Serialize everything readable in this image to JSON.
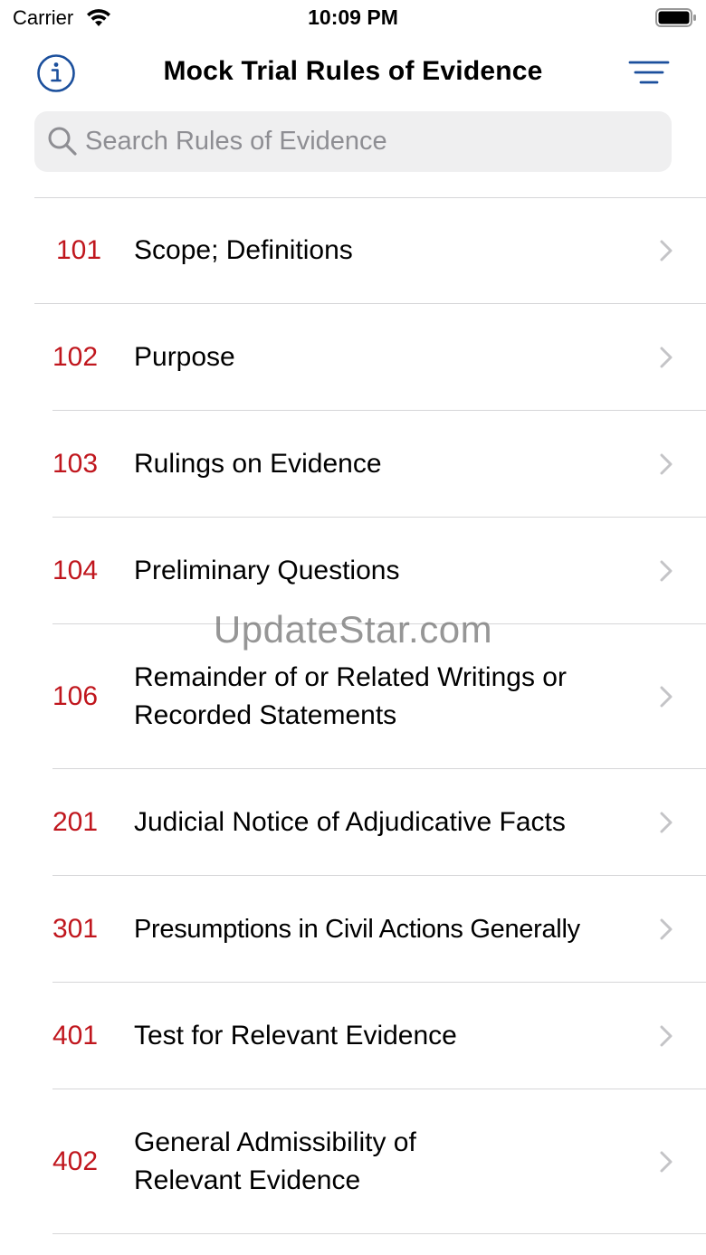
{
  "status_bar": {
    "carrier": "Carrier",
    "time": "10:09 PM"
  },
  "nav": {
    "title": "Mock Trial Rules of Evidence",
    "info_icon": "info-circle-icon",
    "filter_icon": "filter-lines-icon"
  },
  "search": {
    "placeholder": "Search Rules of Evidence",
    "value": ""
  },
  "rules": [
    {
      "number": "101",
      "title": "Scope; Definitions"
    },
    {
      "number": "102",
      "title": "Purpose"
    },
    {
      "number": "103",
      "title": "Rulings on Evidence"
    },
    {
      "number": "104",
      "title": "Preliminary Questions"
    },
    {
      "number": "106",
      "title": "Remainder of or Related Writings or Recorded Statements"
    },
    {
      "number": "201",
      "title": "Judicial Notice of Adjudicative Facts"
    },
    {
      "number": "301",
      "title": "Presumptions in Civil Actions Generally"
    },
    {
      "number": "401",
      "title": "Test for Relevant Evidence"
    },
    {
      "number": "402",
      "title": "General Admissibility of Relevant Evidence"
    }
  ],
  "watermark": "UpdateStar.com",
  "colors": {
    "accent": "#1b4f9c",
    "rule_number": "#c0161d",
    "separator": "#d6d6d8",
    "search_bg": "#efeff0"
  }
}
